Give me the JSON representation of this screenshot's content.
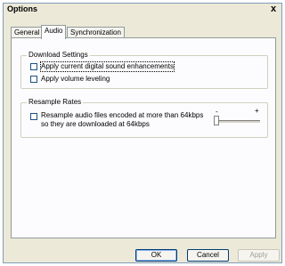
{
  "window": {
    "title": "Options",
    "close_symbol": "x"
  },
  "tabs": [
    {
      "label": "General"
    },
    {
      "label": "Audio",
      "active": true
    },
    {
      "label": "Synchronization"
    }
  ],
  "download_settings": {
    "legend": "Download Settings",
    "options": [
      {
        "label": "Apply current digital sound enhancements",
        "checked": false
      },
      {
        "label": "Apply volume leveling",
        "checked": false
      }
    ]
  },
  "resample_rates": {
    "legend": "Resample Rates",
    "option_line1": "Resample audio files encoded at more than 64kbps",
    "option_line2": "so they are downloaded at 64kbps",
    "checked": false,
    "slider_min_symbol": "-",
    "slider_max_symbol": "+",
    "slider_level": 0
  },
  "buttons": {
    "ok": "OK",
    "cancel": "Cancel",
    "apply": "Apply"
  }
}
